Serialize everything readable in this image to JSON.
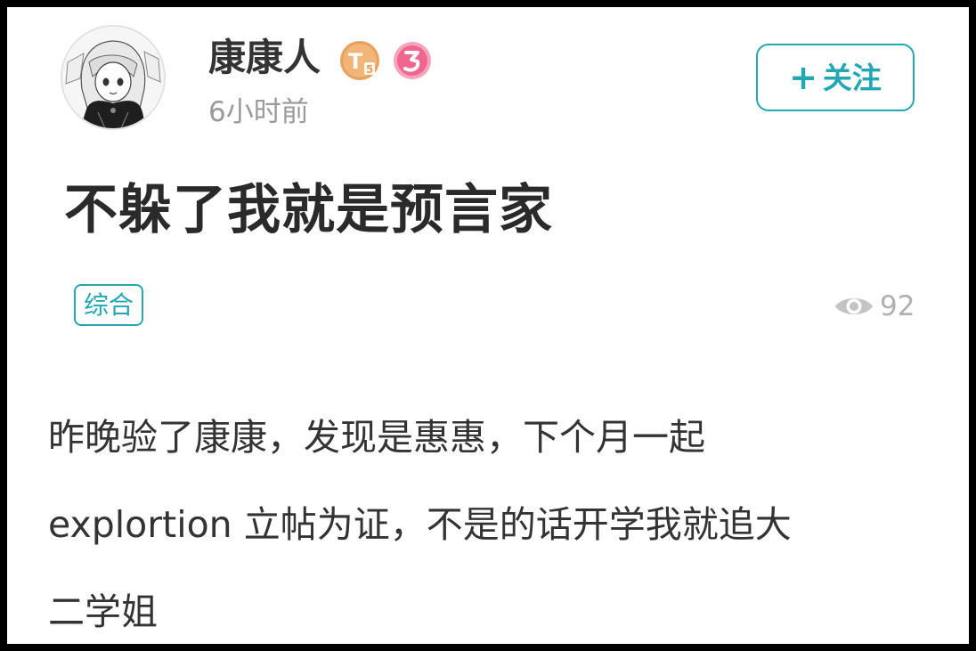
{
  "user": {
    "name": "康康人",
    "level_badge": "T5",
    "second_badge": "3",
    "timestamp": "6小时前",
    "avatar_icon": "anime-girl-avatar"
  },
  "follow_button": {
    "plus": "+",
    "label": "关注"
  },
  "post": {
    "title": "不躲了我就是预言家",
    "tag": "综合",
    "views": "92",
    "body_lines": [
      "昨晚验了康康，发现是惠惠，下个月一起",
      "explortion 立帖为证，不是的话开学我就追大",
      "二学姐"
    ]
  },
  "colors": {
    "accent": "#25a7b3",
    "badge_orange": "#e8a15c",
    "badge_pink": "#f0668f",
    "text_primary": "#333333",
    "text_muted": "#9a9a9a"
  }
}
